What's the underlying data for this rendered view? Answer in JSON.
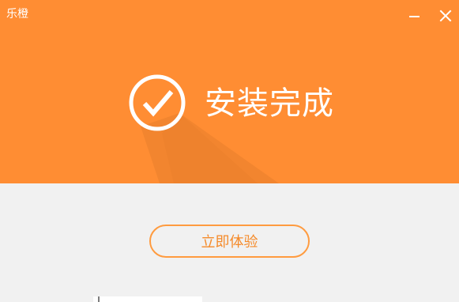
{
  "window": {
    "title": "乐橙"
  },
  "main": {
    "completion_title": "安装完成",
    "action_button": "立即体验"
  },
  "icons": {
    "success": "check-circle-icon",
    "minimize": "minimize-icon",
    "close": "close-icon"
  },
  "colors": {
    "accent": "#ff8d33",
    "background": "#f1f1f1",
    "button_border": "#ff9b3f",
    "button_text": "#f58b2b",
    "text_on_accent": "#ffffff"
  }
}
